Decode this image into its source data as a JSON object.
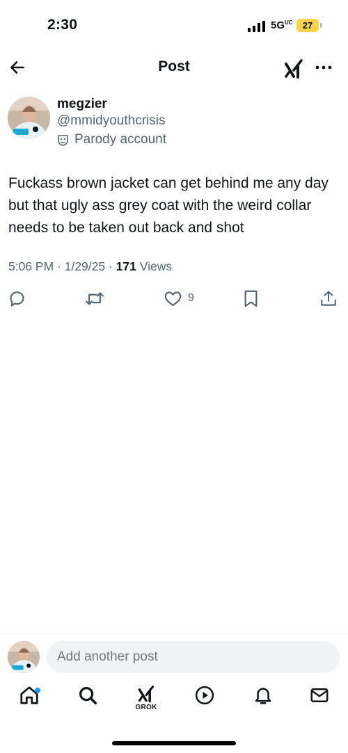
{
  "status_bar": {
    "time": "2:30",
    "network": "5G",
    "network_sup": "UC",
    "battery": "27"
  },
  "header": {
    "title": "Post",
    "back_icon": "arrow-left-icon",
    "grok_icon": "grok-icon",
    "more_icon": "more-icon"
  },
  "post": {
    "display_name": "megzier",
    "handle": "@mmidyouthcrisis",
    "badge_label": "Parody account",
    "text": "Fuckass brown jacket can get behind me any day but that ugly ass grey coat with the weird collar needs to be taken out back and shot",
    "timestamp": "5:06 PM · 1/29/25 · ",
    "views_count": "171",
    "views_label": " Views",
    "actions": {
      "reply_count": "",
      "repost_count": "",
      "like_count": "9",
      "bookmark_count": ""
    }
  },
  "reply": {
    "placeholder": "Add another post"
  },
  "tabbar": {
    "items": [
      {
        "name": "home",
        "icon": "home-icon",
        "active": true,
        "badge": true
      },
      {
        "name": "search",
        "icon": "search-icon"
      },
      {
        "name": "grok",
        "icon": "grok-icon",
        "label": "GROK"
      },
      {
        "name": "media",
        "icon": "play-icon"
      },
      {
        "name": "notifications",
        "icon": "bell-icon"
      },
      {
        "name": "messages",
        "icon": "mail-icon"
      }
    ]
  },
  "colors": {
    "text": "#0f1419",
    "secondary": "#536471",
    "accent": "#1d9bf0",
    "battery": "#f6d34a",
    "input_bg": "#eff3f4"
  }
}
